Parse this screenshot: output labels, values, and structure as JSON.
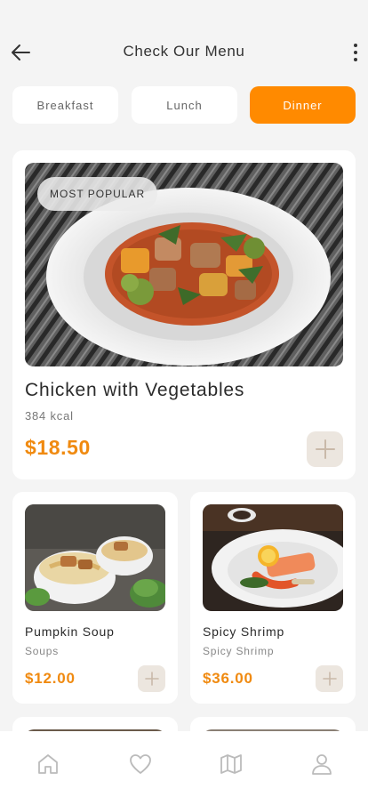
{
  "header": {
    "title": "Check Our Menu",
    "back_icon": "arrow-left-icon",
    "more_icon": "more-vertical-icon"
  },
  "tabs": [
    {
      "label": "Breakfast",
      "active": false
    },
    {
      "label": "Lunch",
      "active": false
    },
    {
      "label": "Dinner",
      "active": true
    }
  ],
  "featured": {
    "badge": "MOST POPULAR",
    "name": "Chicken with Vegetables",
    "kcal": "384 kcal",
    "price": "$18.50",
    "image": "chicken-vegetables-dish-photo"
  },
  "items": [
    {
      "name": "Pumpkin Soup",
      "category": "Soups",
      "price": "$12.00",
      "image": "noodle-bowl-photo"
    },
    {
      "name": "Spicy Shrimp",
      "category": "Spicy Shrimp",
      "price": "$36.00",
      "image": "shrimp-salmon-plate-photo"
    }
  ],
  "nav": [
    {
      "icon": "home-icon"
    },
    {
      "icon": "heart-icon"
    },
    {
      "icon": "map-icon"
    },
    {
      "icon": "user-icon"
    }
  ],
  "colors": {
    "accent": "#ff8a00",
    "price": "#f08a10",
    "background": "#f4f4f4"
  }
}
